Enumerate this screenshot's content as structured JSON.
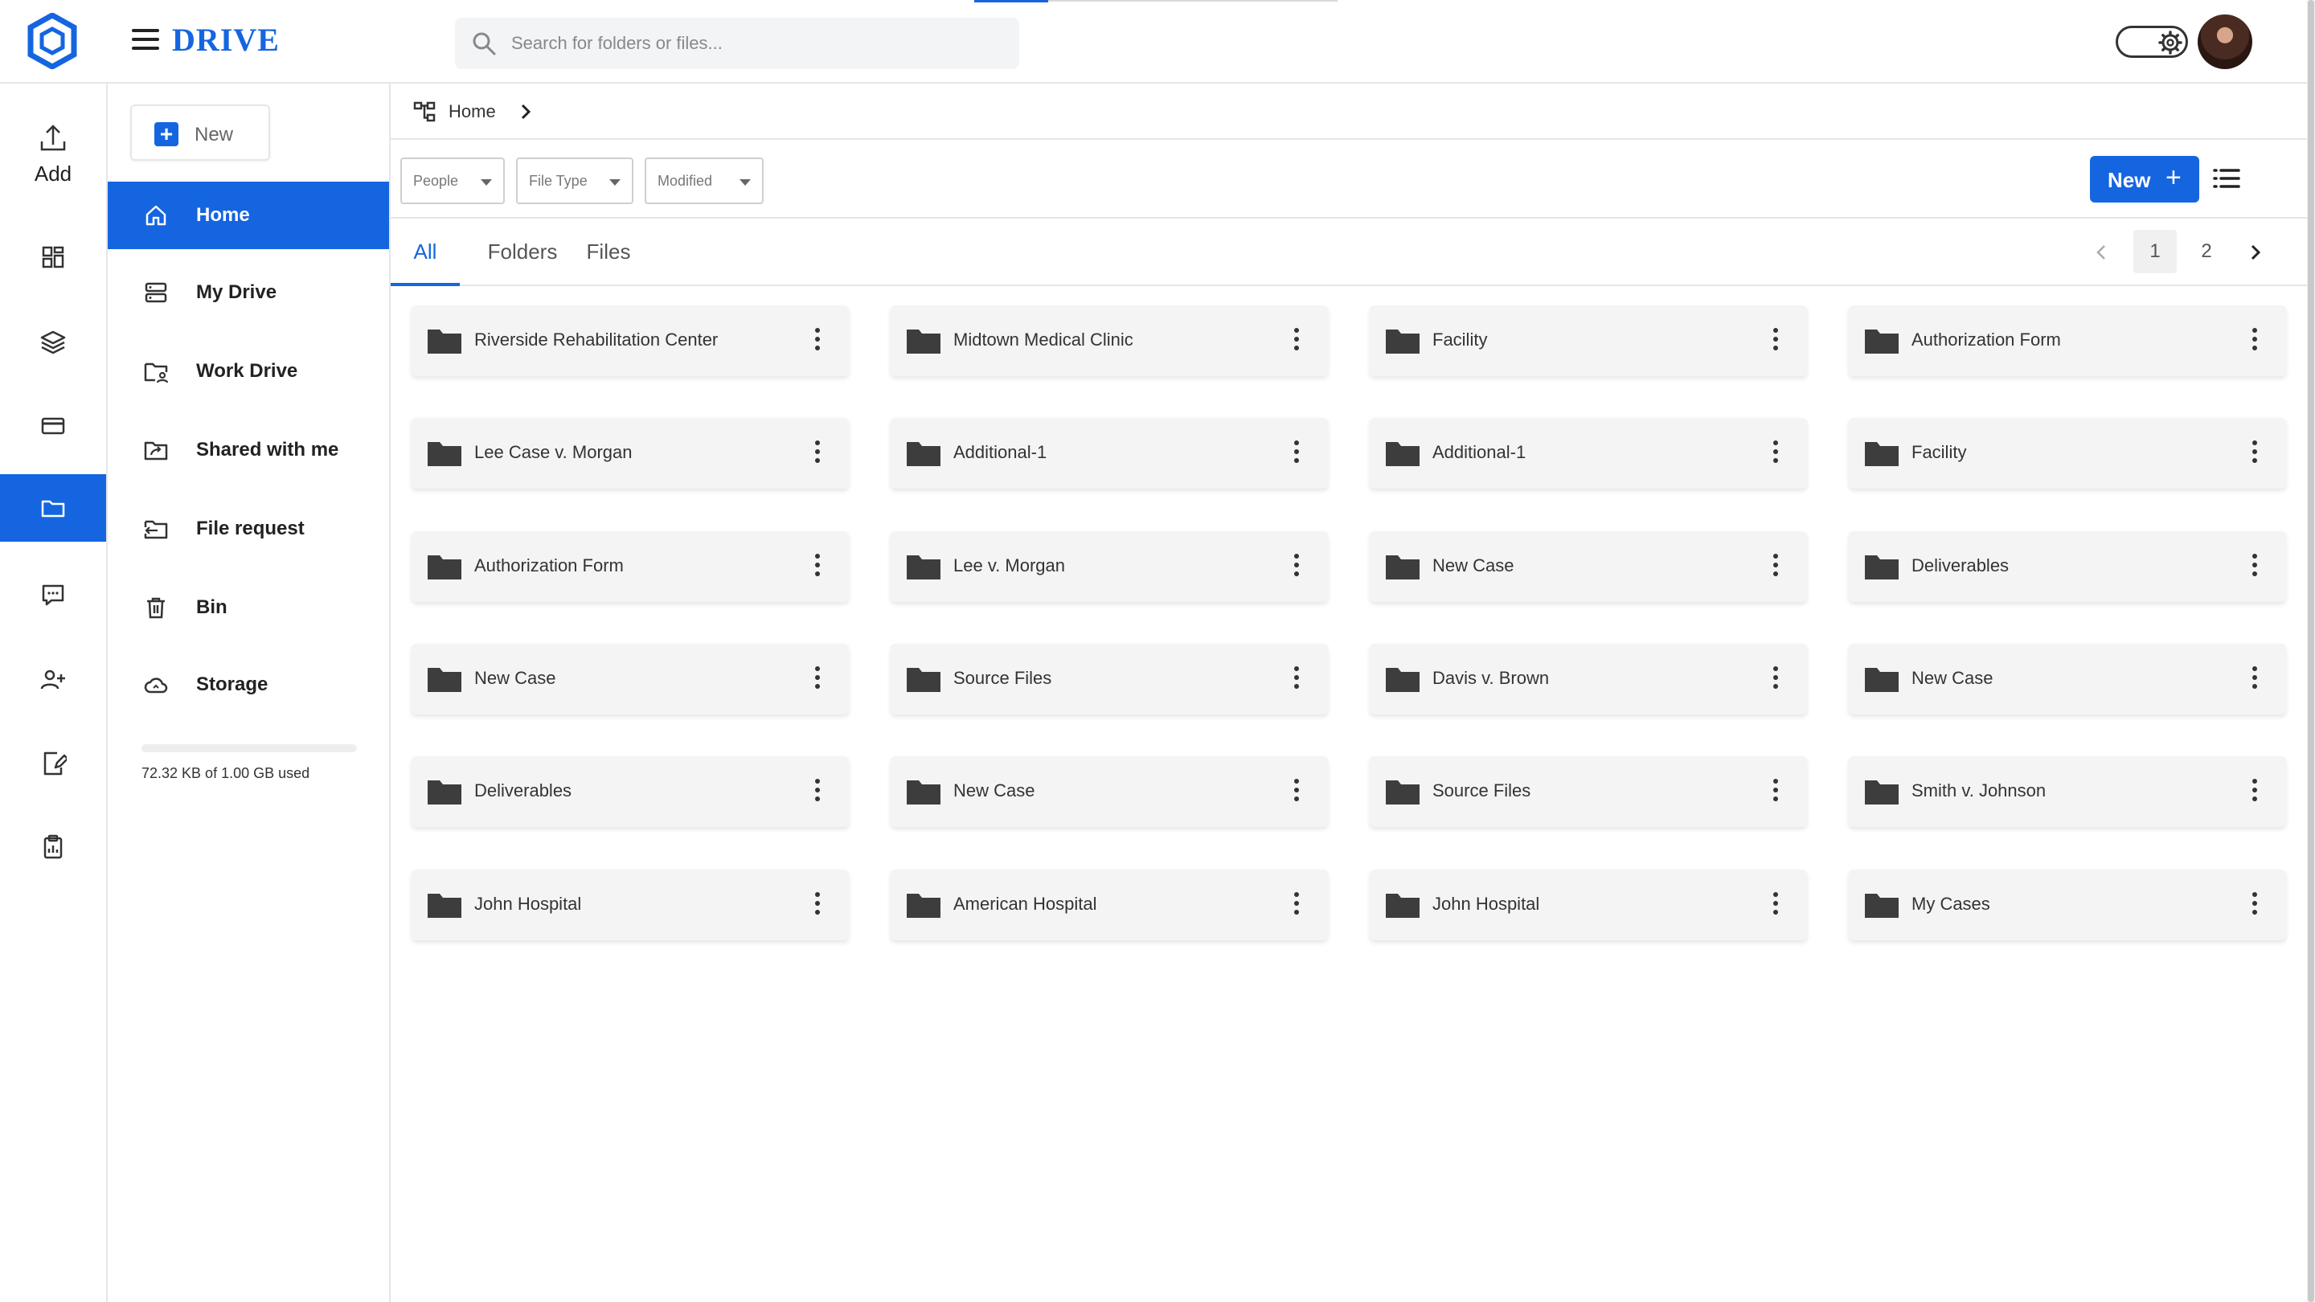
{
  "app": {
    "brand": "DRIVE",
    "accent": "#1565e0"
  },
  "search": {
    "placeholder": "Search for folders or files..."
  },
  "rail": {
    "add_label": "Add",
    "items": [
      {
        "icon": "dashboard-icon"
      },
      {
        "icon": "layers-icon"
      },
      {
        "icon": "card-icon"
      },
      {
        "icon": "folder-icon",
        "active": true
      },
      {
        "icon": "chat-icon"
      },
      {
        "icon": "users-icon"
      },
      {
        "icon": "edit-document-icon"
      },
      {
        "icon": "clipboard-icon"
      }
    ]
  },
  "sidebar": {
    "new_label": "New",
    "items": [
      {
        "label": "Home",
        "icon": "home-icon",
        "active": true
      },
      {
        "label": "My Drive",
        "icon": "drive-icon"
      },
      {
        "label": "Work Drive",
        "icon": "shared-folder-icon"
      },
      {
        "label": "Shared with me",
        "icon": "share-folder-icon"
      },
      {
        "label": "File request",
        "icon": "file-request-icon"
      },
      {
        "label": "Bin",
        "icon": "trash-icon"
      },
      {
        "label": "Storage",
        "icon": "cloud-icon"
      }
    ],
    "storage_text": "72.32 KB of 1.00 GB used",
    "storage_used_fraction": 0.0001
  },
  "breadcrumb": {
    "home": "Home"
  },
  "filters": [
    "People",
    "File Type",
    "Modified"
  ],
  "toolbar": {
    "new_label": "New"
  },
  "tabs": [
    "All",
    "Folders",
    "Files"
  ],
  "pager": {
    "pages": [
      "1",
      "2"
    ],
    "current": "1"
  },
  "folders": [
    [
      "Riverside Rehabilitation Center",
      "Midtown Medical Clinic",
      "Facility",
      "Authorization Form"
    ],
    [
      "Lee Case v. Morgan",
      "Additional-1",
      "Additional-1",
      "Facility"
    ],
    [
      "Authorization Form",
      "Lee v. Morgan",
      "New Case",
      "Deliverables"
    ],
    [
      "New Case",
      "Source Files",
      "Davis v. Brown",
      "New Case"
    ],
    [
      "Deliverables",
      "New Case",
      "Source Files",
      "Smith v. Johnson"
    ],
    [
      "John Hospital",
      "American Hospital",
      "John Hospital",
      "My Cases"
    ]
  ]
}
